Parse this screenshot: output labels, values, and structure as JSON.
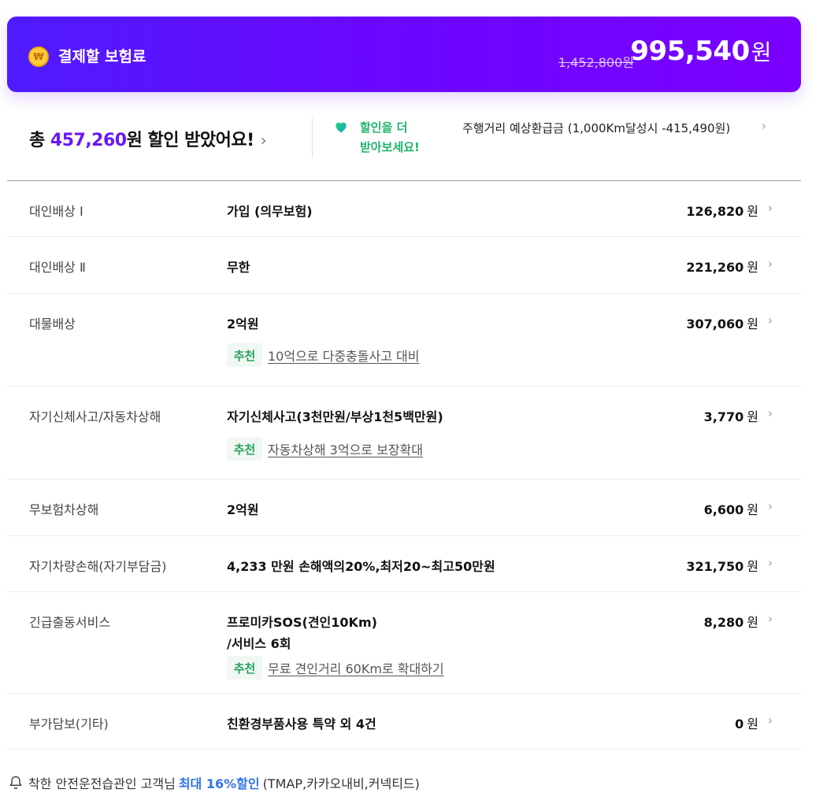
{
  "header": {
    "title": "결제할 보험료",
    "coin_symbol": "₩",
    "original_price": "1,452,800원",
    "total_amount": "995,540",
    "total_unit": "원"
  },
  "summary": {
    "prefix": "총 ",
    "discount_amount": "457,260",
    "suffix": "원 할인 받았어요!",
    "chevron": "›",
    "more_line1": "할인을 더",
    "more_line2": "받아보세요!",
    "refund_text": "주행거리 예상환급금 (1,000Km달성시 -415,490원)",
    "refund_chevron": "›"
  },
  "coverages": [
    {
      "label": "대인배상 Ⅰ",
      "value": "가입 (의무보험)",
      "price": "126,820",
      "unit": "원"
    },
    {
      "label": "대인배상 Ⅱ",
      "value": "무한",
      "price": "221,260",
      "unit": "원"
    },
    {
      "label": "대물배상",
      "value": "2억원",
      "price": "307,060",
      "unit": "원",
      "rec_tag": "추천",
      "rec_text": "10억으로 다중충돌사고 대비"
    },
    {
      "label": "자기신체사고/자동차상해",
      "value": "자기신체사고(3천만원/부상1천5백만원)",
      "price": "3,770",
      "unit": "원",
      "rec_tag": "추천",
      "rec_text": "자동차상해 3억으로 보장확대"
    },
    {
      "label": "무보험차상해",
      "value": "2억원",
      "price": "6,600",
      "unit": "원"
    },
    {
      "label": "자기차량손해(자기부담금)",
      "value": "4,233 만원 손해액의20%,최저20~최고50만원",
      "price": "321,750",
      "unit": "원"
    },
    {
      "label": "긴급출동서비스",
      "value_line1": "프로미카SOS(견인10Km)",
      "value_line2": "/서비스 6회",
      "price": "8,280",
      "unit": "원",
      "rec_tag": "추천",
      "rec_text": "무료 견인거리 60Km로 확대하기"
    },
    {
      "label": "부가담보(기타)",
      "value": "친환경부품사용 특약 외 4건",
      "price": "0",
      "unit": "원"
    }
  ],
  "row_chevron": "›",
  "footer": {
    "text_before": "착한 안전운전습관인 고객님",
    "highlight": "최대 16%할인",
    "text_after": "(TMAP,카카오내비,커넥티드)"
  },
  "colors": {
    "header_gradient_start": "#4f1bff",
    "header_gradient_end": "#7a00ff",
    "discount_accent": "#6b17f4",
    "recommend_green": "#27a35f",
    "link_blue": "#2f74e8"
  }
}
